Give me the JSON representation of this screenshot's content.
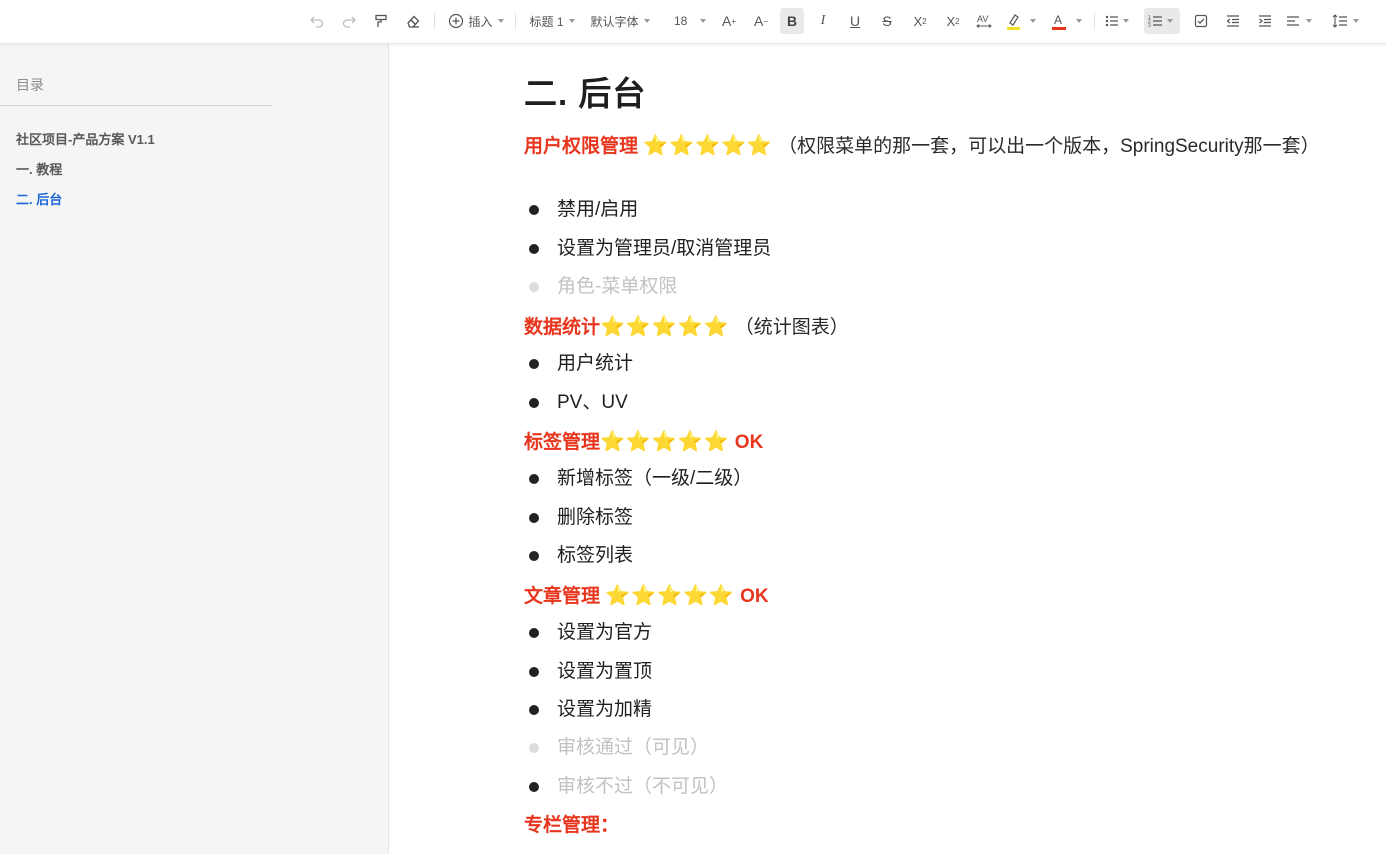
{
  "toolbar": {
    "insert_label": "插入",
    "heading_label": "标题 1",
    "font_label": "默认字体",
    "size_label": "18",
    "accent_highlight": "#f2e12a",
    "accent_fontcolor": "#e8361e"
  },
  "sidebar": {
    "title": "目录",
    "items": [
      {
        "label": "社区项目-产品方案  V1.1"
      },
      {
        "label": "一.  教程"
      },
      {
        "label": "二.  后台"
      }
    ],
    "current_color": "#1a66d6"
  },
  "doc": {
    "heading": "二. 后台",
    "sections": [
      {
        "title": "用户权限管理",
        "stars": "⭐️⭐️⭐️⭐️⭐️",
        "suffix": " （权限菜单的那一套，可以出一个版本，SpringSecurity那一套）",
        "items": [
          "禁用/启用",
          "设置为管理员/取消管理员",
          "角色-菜单权限"
        ]
      },
      {
        "title": "数据统计",
        "stars": "⭐️⭐️⭐️⭐️⭐️",
        "suffix": " （统计图表）",
        "items": [
          "用户统计",
          "PV、UV"
        ]
      },
      {
        "title": "标签管理",
        "stars": "⭐️⭐️⭐️⭐️⭐️",
        "suffix_red": " OK",
        "items": [
          "新增标签（一级/二级）",
          "删除标签",
          "标签列表"
        ]
      },
      {
        "title": "文章管理",
        "stars": "⭐️⭐️⭐️⭐️⭐️",
        "suffix_red": "  OK",
        "items": [
          "设置为官方",
          "设置为置顶",
          "设置为加精",
          "审核通过（可见）",
          "审核不过（不可见）"
        ]
      },
      {
        "title": "专栏管理："
      }
    ]
  }
}
